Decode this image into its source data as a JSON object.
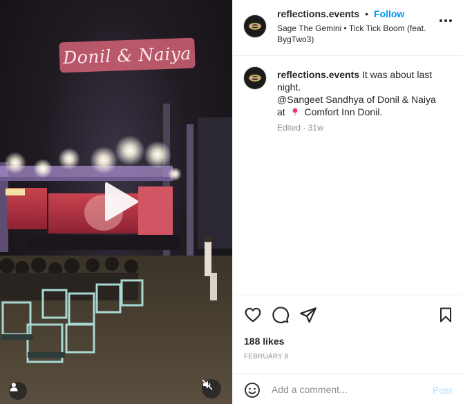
{
  "media": {
    "overlay_title": "Donil & Naiya",
    "accent": "#e2687c"
  },
  "post": {
    "username": "reflections.events",
    "follow_label": "Follow",
    "audio": "Sage The Gemini • Tick Tick Boom (feat. BygTwo3)",
    "caption": {
      "line1": "It was about last night.",
      "mention": "@Sangeet Sandhya of Donil & Naiya",
      "at_text": "at",
      "location": "Comfort Inn Donil."
    },
    "edited": "Edited",
    "time_ago": "31w",
    "likes": "188 likes",
    "date": "FEBRUARY 8"
  },
  "comment": {
    "placeholder": "Add a comment...",
    "post_label": "Post"
  },
  "colors": {
    "follow": "#0095f6",
    "post_disabled": "#b2dffc",
    "muted_text": "#8e8e8e"
  }
}
